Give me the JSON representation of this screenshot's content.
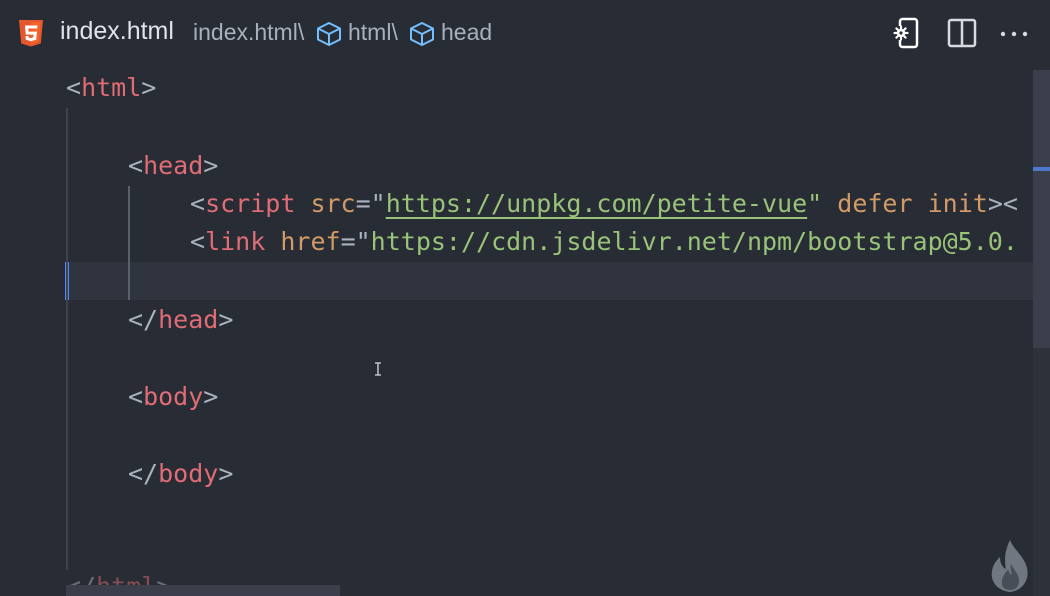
{
  "tab": {
    "file_icon": "html5-icon",
    "title": "index.html"
  },
  "breadcrumb": [
    {
      "label": "index.html\\"
    },
    {
      "icon": "cube-icon",
      "label": "html\\"
    },
    {
      "icon": "cube-icon",
      "label": "head"
    }
  ],
  "toolbar": {
    "preview_icon": "open-preview-icon",
    "split_icon": "split-editor-icon",
    "more_icon": "more-actions-icon"
  },
  "code": {
    "line1": {
      "open": "<",
      "tag": "html",
      "close": ">"
    },
    "line3": {
      "open": "<",
      "tag": "head",
      "close": ">"
    },
    "line4": {
      "open": "<",
      "tag": "script",
      "space1": " ",
      "attr1": "src",
      "eq1": "=\"",
      "url": "https://unpkg.com/petite-vue",
      "quote": "\"",
      "space2": " ",
      "attr2": "defer",
      "space3": " ",
      "attr3": "init",
      "close": "><"
    },
    "line5": {
      "open": "<",
      "tag": "link",
      "space1": " ",
      "attr1": "href",
      "eq1": "=\"",
      "url": "https://cdn.jsdelivr.net/npm/bootstrap@5.0."
    },
    "line7": {
      "open": "</",
      "tag": "head",
      "close": ">"
    },
    "line9": {
      "open": "<",
      "tag": "body",
      "close": ">"
    },
    "line11": {
      "open": "</",
      "tag": "body",
      "close": ">"
    },
    "line14": {
      "open": "</",
      "tag": "html",
      "close": ">"
    }
  },
  "colors": {
    "background": "#282c34",
    "tag": "#e06c75",
    "attribute": "#d19a66",
    "string": "#98c379",
    "punctuation": "#abb2bf",
    "cursor_line_marker": "#528bff"
  },
  "watermark_icon": "flame-icon"
}
